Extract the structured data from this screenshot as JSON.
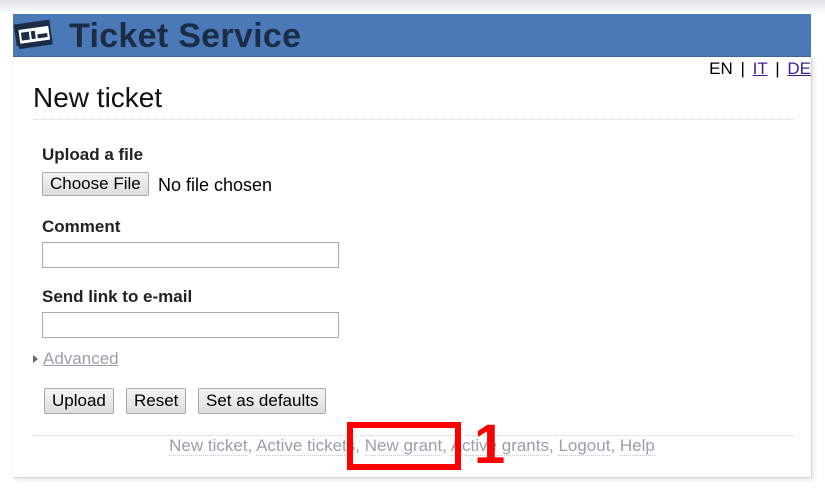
{
  "header": {
    "app_title": "Ticket Service",
    "logo_icon": "ticket-logo-icon",
    "color": "#4b78b6"
  },
  "languages": {
    "current": "EN",
    "options": [
      "IT",
      "DE"
    ],
    "separator": "|"
  },
  "page": {
    "title": "New ticket"
  },
  "form": {
    "upload_label": "Upload a file",
    "choose_file_label": "Choose File",
    "file_status": "No file chosen",
    "comment_label": "Comment",
    "comment_value": "",
    "email_label": "Send link to e-mail",
    "email_value": "",
    "advanced_label": "Advanced",
    "buttons": {
      "upload": "Upload",
      "reset": "Reset",
      "set_defaults": "Set as defaults"
    }
  },
  "footer": {
    "links": [
      "New ticket",
      "Active tickets",
      "New grant",
      "Active grants",
      "Logout",
      "Help"
    ],
    "separator": ", "
  },
  "annotation": {
    "marker": "1",
    "color": "#ff0000"
  }
}
